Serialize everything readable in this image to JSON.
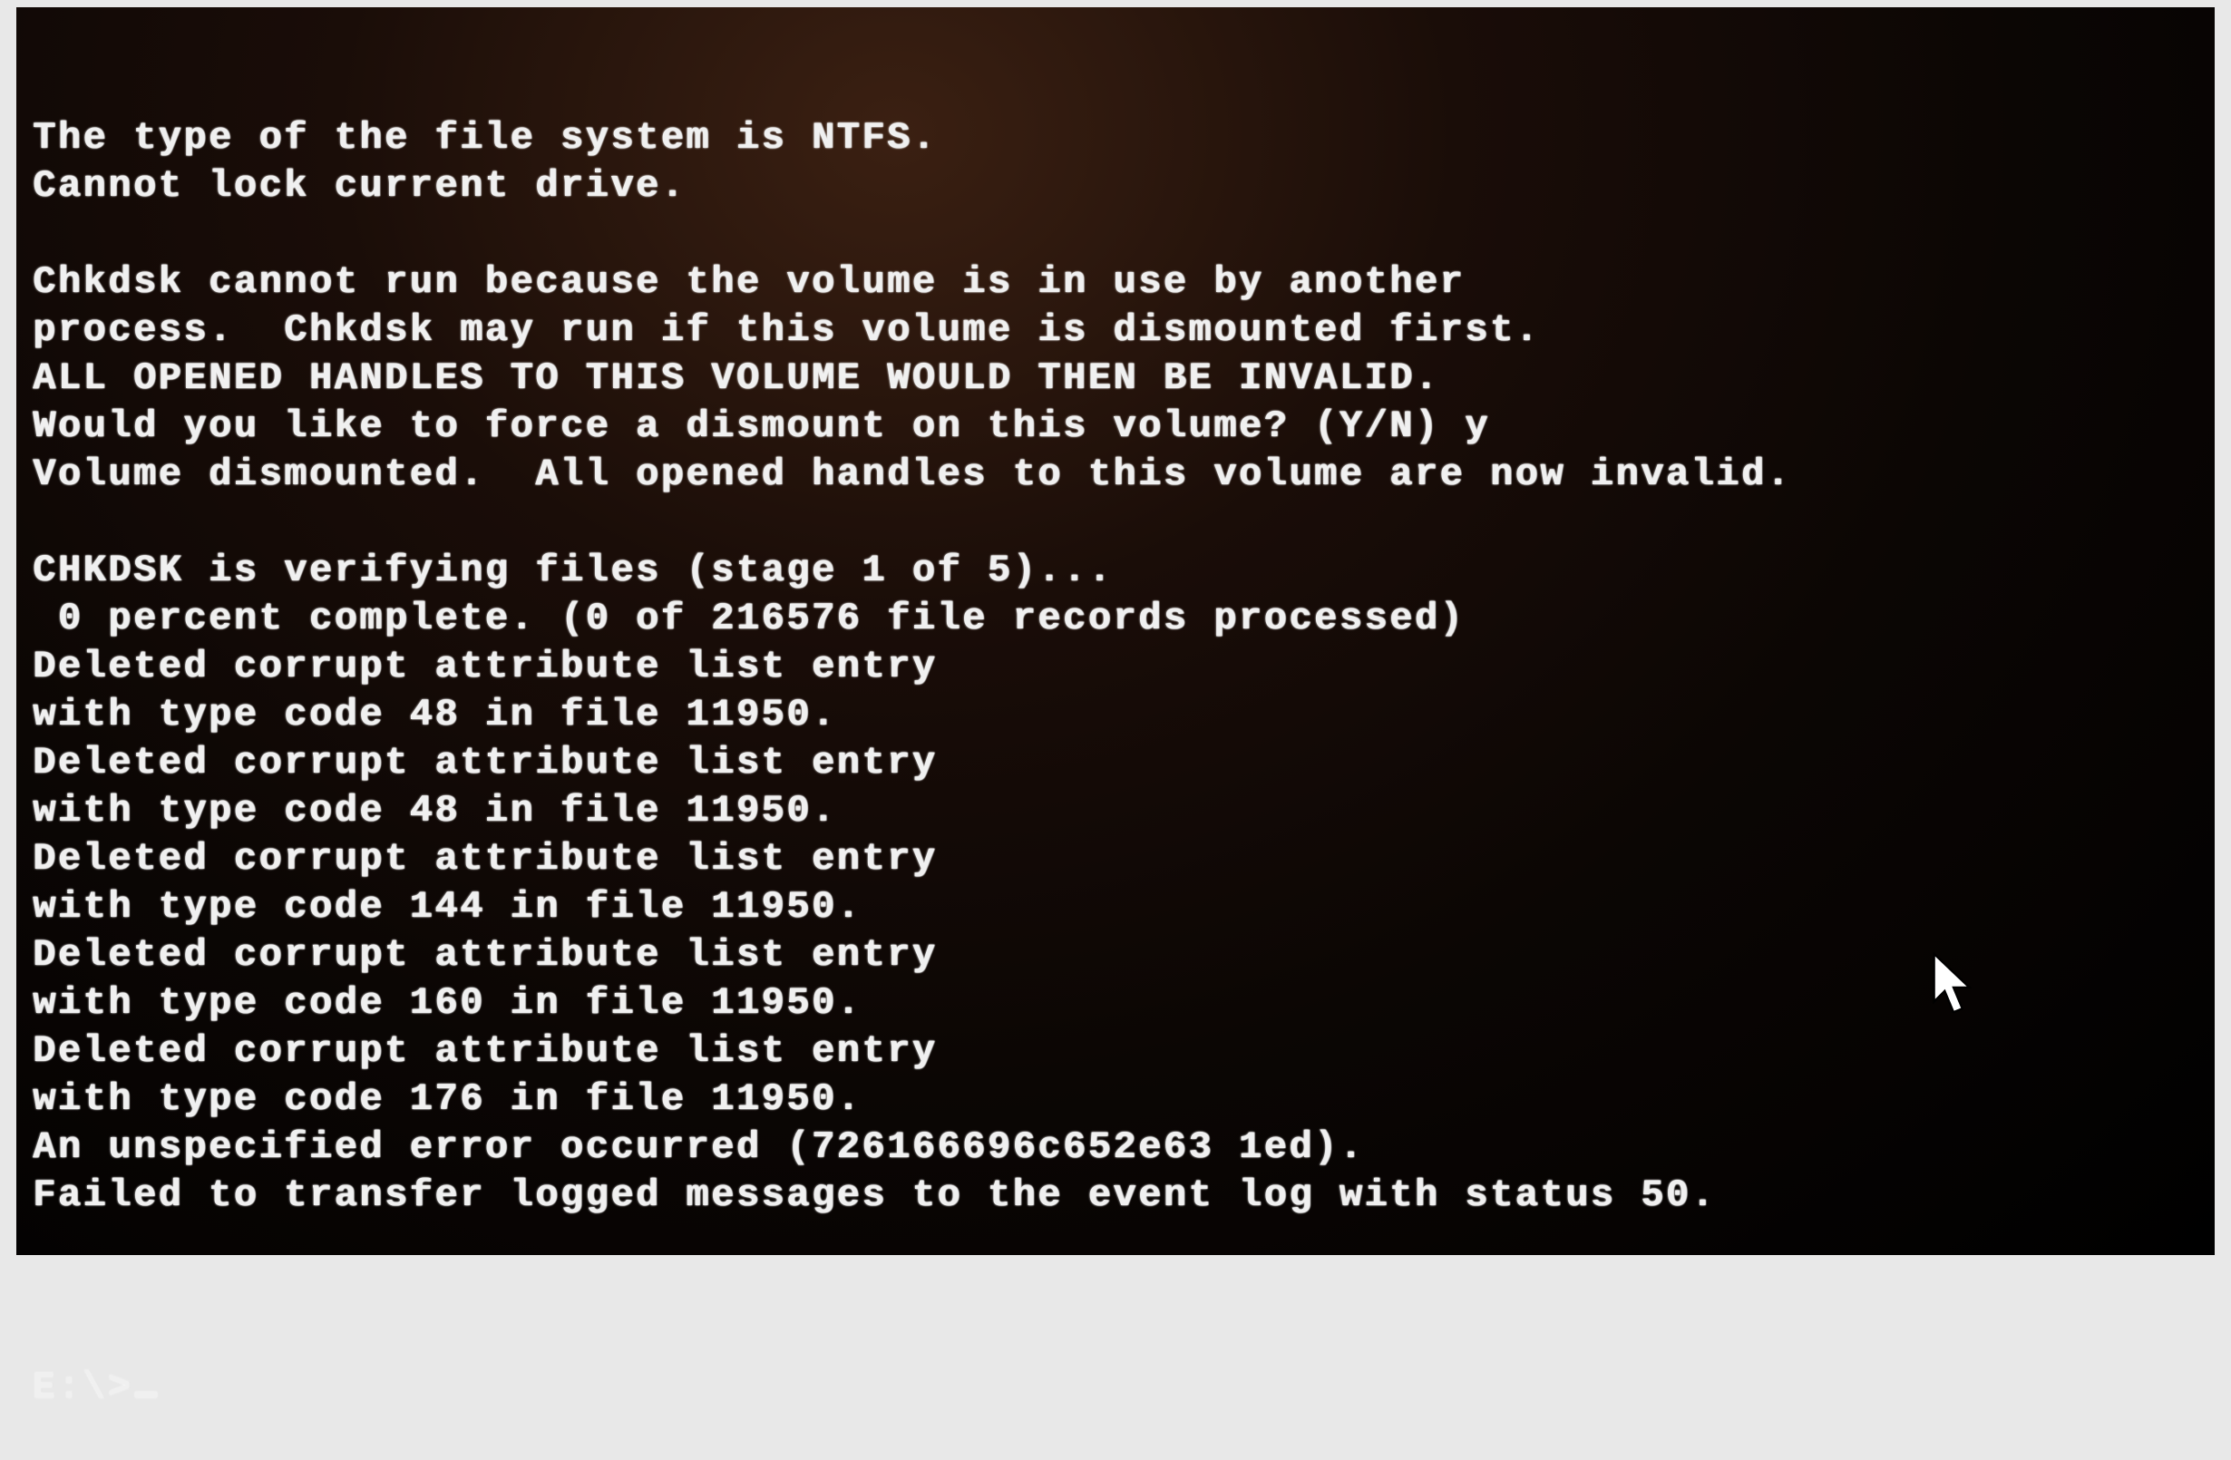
{
  "terminal": {
    "lines": [
      "The type of the file system is NTFS.",
      "Cannot lock current drive.",
      "",
      "Chkdsk cannot run because the volume is in use by another",
      "process.  Chkdsk may run if this volume is dismounted first.",
      "ALL OPENED HANDLES TO THIS VOLUME WOULD THEN BE INVALID.",
      "Would you like to force a dismount on this volume? (Y/N) y",
      "Volume dismounted.  All opened handles to this volume are now invalid.",
      "",
      "CHKDSK is verifying files (stage 1 of 5)...",
      " 0 percent complete. (0 of 216576 file records processed)",
      "Deleted corrupt attribute list entry",
      "with type code 48 in file 11950.",
      "Deleted corrupt attribute list entry",
      "with type code 48 in file 11950.",
      "Deleted corrupt attribute list entry",
      "with type code 144 in file 11950.",
      "Deleted corrupt attribute list entry",
      "with type code 160 in file 11950.",
      "Deleted corrupt attribute list entry",
      "with type code 176 in file 11950.",
      "An unspecified error occurred (726166696c652e63 1ed).",
      "Failed to transfer logged messages to the event log with status 50.",
      ""
    ],
    "prompt": "E:\\>"
  }
}
